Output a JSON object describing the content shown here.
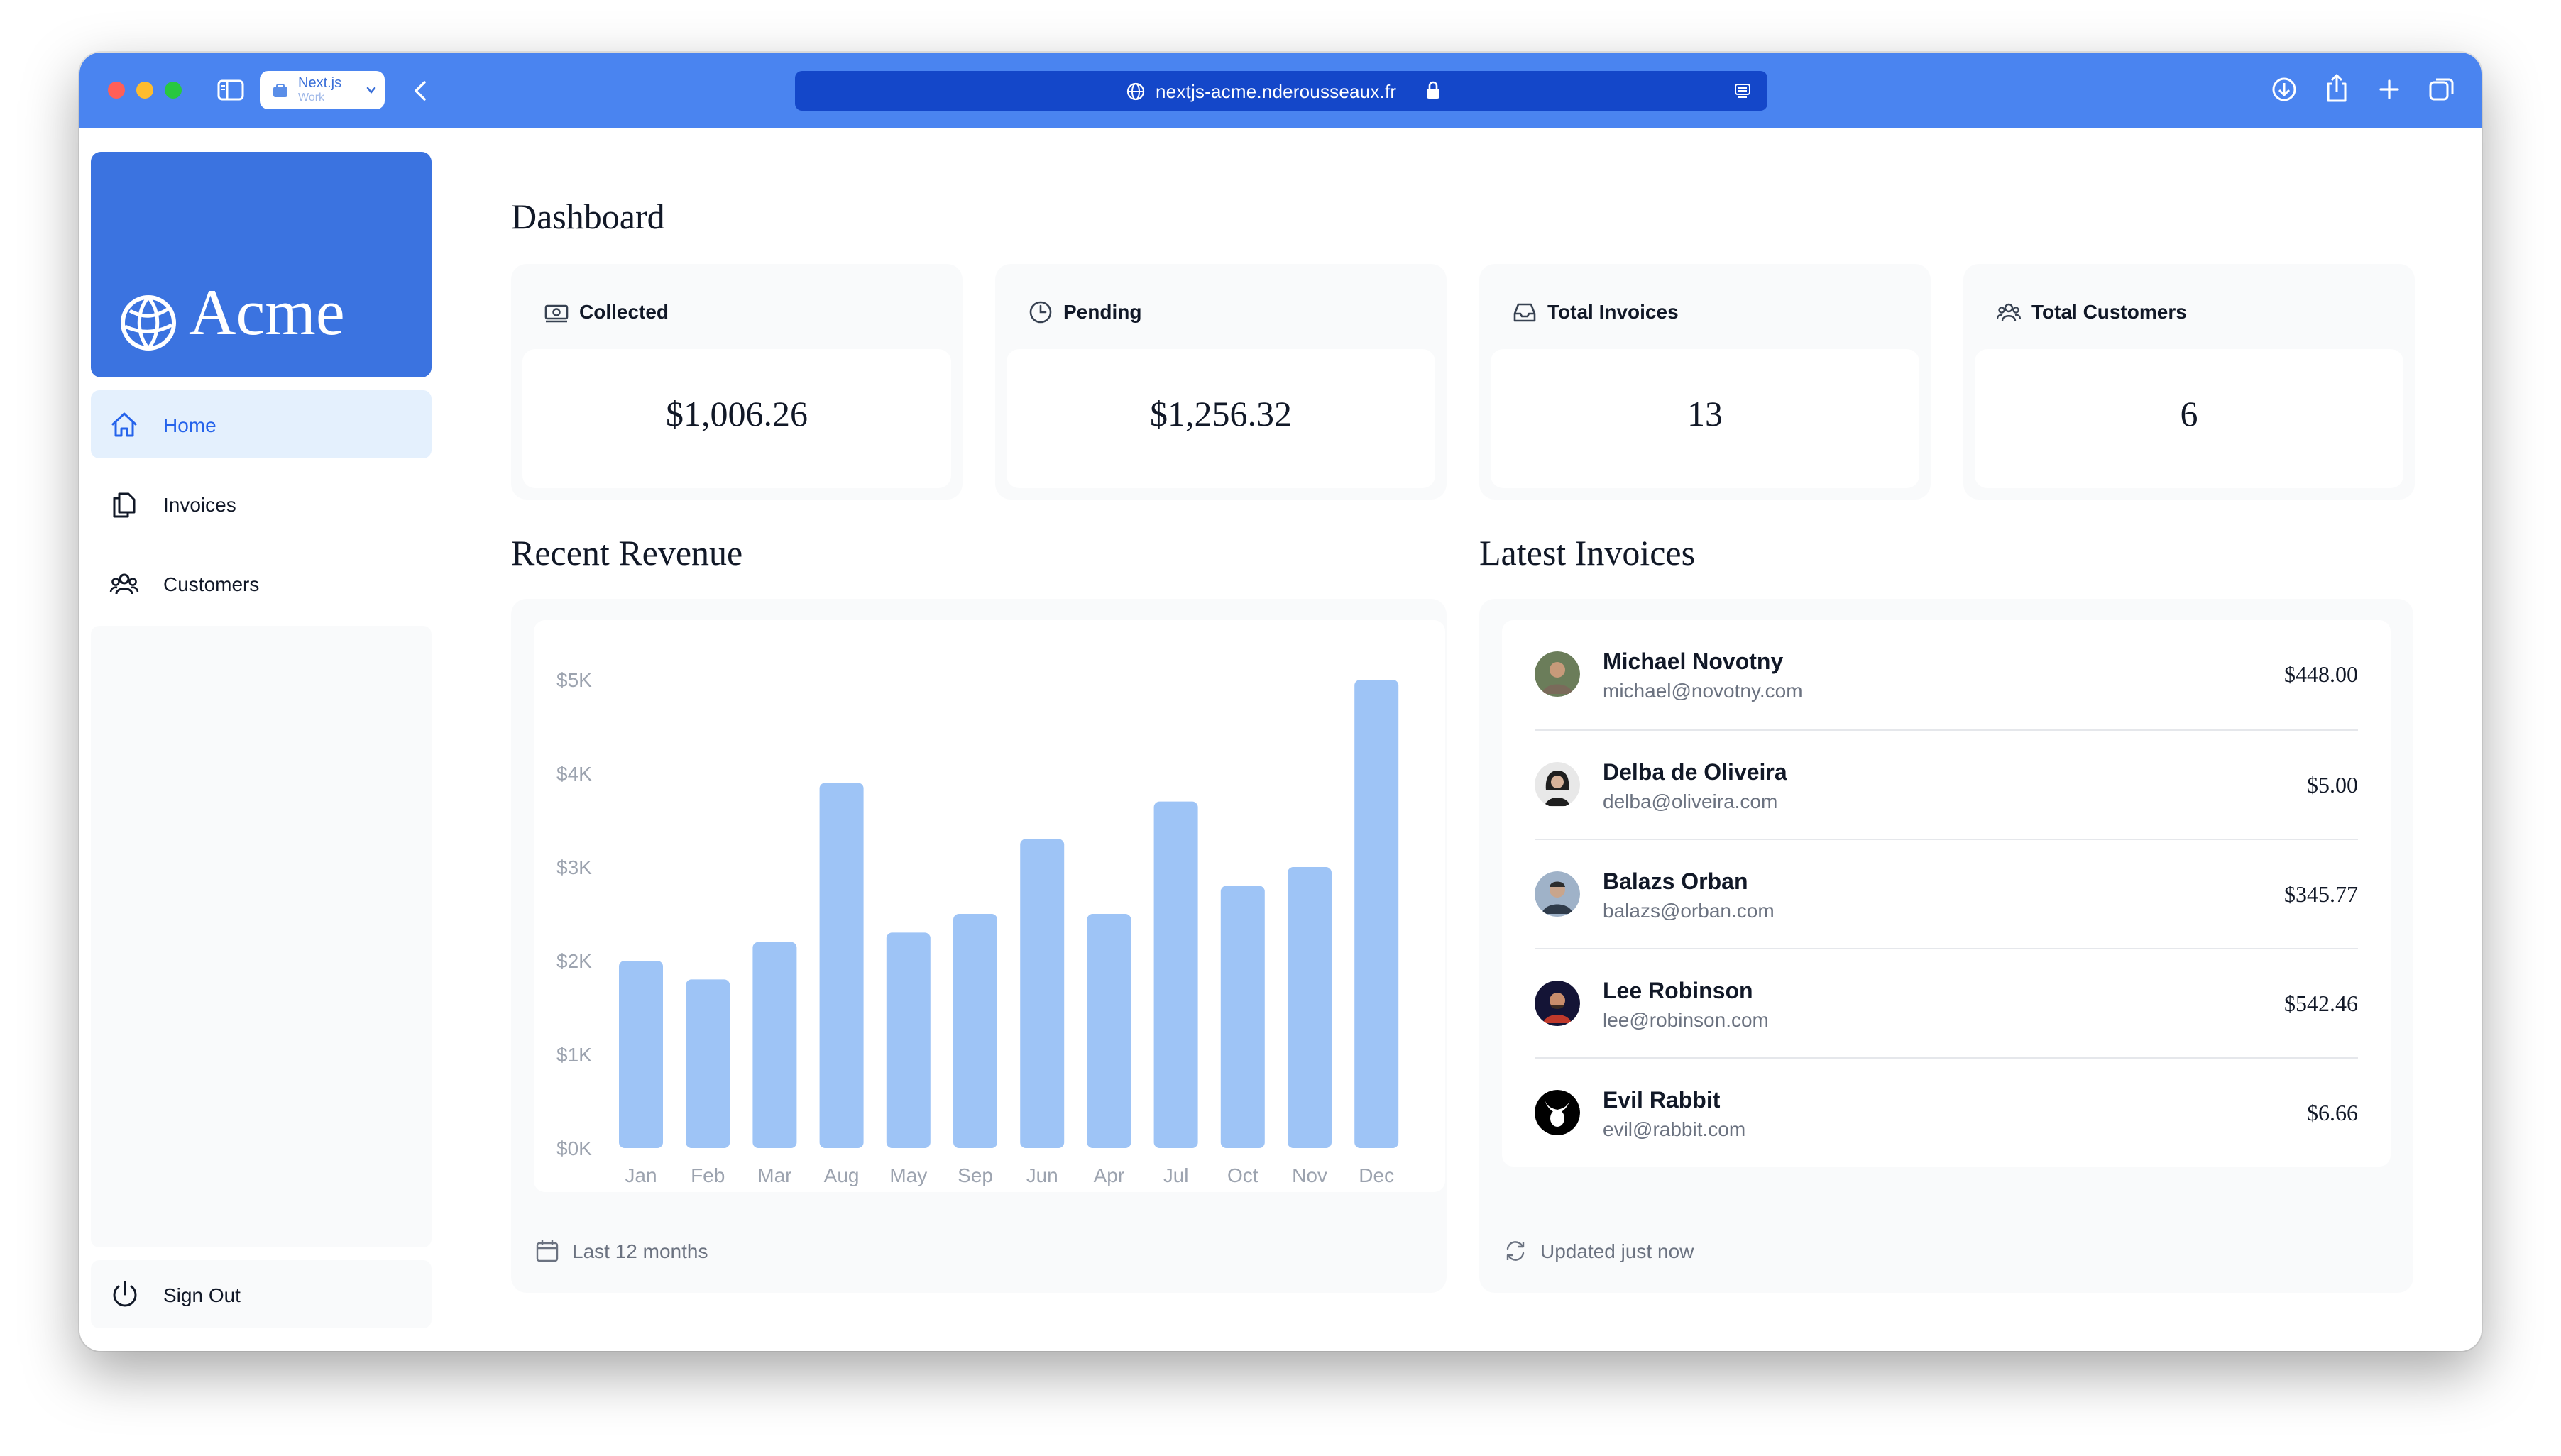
{
  "browser": {
    "tab_group_title": "Next.js",
    "tab_group_subtitle": "Work",
    "url": "nextjs-acme.nderousseaux.fr"
  },
  "sidebar": {
    "logo_text": "Acme",
    "items": [
      {
        "label": "Home",
        "icon": "home-icon",
        "active": true
      },
      {
        "label": "Invoices",
        "icon": "document-duplicate-icon",
        "active": false
      },
      {
        "label": "Customers",
        "icon": "user-group-icon",
        "active": false
      }
    ],
    "sign_out_label": "Sign Out"
  },
  "main": {
    "title": "Dashboard",
    "cards": [
      {
        "label": "Collected",
        "value": "$1,006.26",
        "icon": "banknotes-icon"
      },
      {
        "label": "Pending",
        "value": "$1,256.32",
        "icon": "clock-icon"
      },
      {
        "label": "Total Invoices",
        "value": "13",
        "icon": "inbox-icon"
      },
      {
        "label": "Total Customers",
        "value": "6",
        "icon": "user-group-icon"
      }
    ],
    "revenue": {
      "title": "Recent Revenue",
      "footer": "Last 12 months"
    },
    "latest_invoices": {
      "title": "Latest Invoices",
      "footer": "Updated just now",
      "rows": [
        {
          "name": "Michael Novotny",
          "email": "michael@novotny.com",
          "amount": "$448.00"
        },
        {
          "name": "Delba de Oliveira",
          "email": "delba@oliveira.com",
          "amount": "$5.00"
        },
        {
          "name": "Balazs Orban",
          "email": "balazs@orban.com",
          "amount": "$345.77"
        },
        {
          "name": "Lee Robinson",
          "email": "lee@robinson.com",
          "amount": "$542.46"
        },
        {
          "name": "Evil Rabbit",
          "email": "evil@rabbit.com",
          "amount": "$6.66"
        }
      ]
    }
  },
  "colors": {
    "accent": "#3b73e0",
    "bar": "#9ec4f6",
    "toolbar": "#4a84f0",
    "address_bar": "#1447c9"
  },
  "chart_data": {
    "type": "bar",
    "categories": [
      "Jan",
      "Feb",
      "Mar",
      "Aug",
      "May",
      "Sep",
      "Jun",
      "Apr",
      "Jul",
      "Oct",
      "Nov",
      "Dec"
    ],
    "values": [
      2000,
      1800,
      2200,
      3900,
      2300,
      2500,
      3300,
      2500,
      3700,
      2800,
      3000,
      5000
    ],
    "y_ticks": [
      "$0K",
      "$1K",
      "$2K",
      "$3K",
      "$4K",
      "$5K"
    ],
    "ylim": [
      0,
      5000
    ],
    "grid": false,
    "title": "",
    "xlabel": "",
    "ylabel": ""
  }
}
